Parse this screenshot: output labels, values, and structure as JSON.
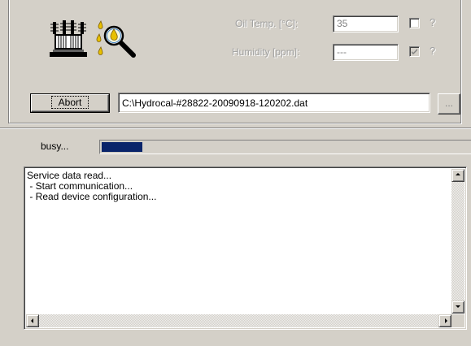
{
  "measurement": {
    "oil_temp_label": "Oil Temp. [°C]:",
    "oil_temp_value": "35",
    "oil_temp_checked": false,
    "oil_temp_help": "?",
    "humidity_label": "Humidity [ppm]:",
    "humidity_value": "---",
    "humidity_checked": true,
    "humidity_help": "?"
  },
  "icons": {
    "transformer": "transformer-icon",
    "sample_inspect": "oil-drop-magnifier-icon"
  },
  "file_row": {
    "abort_label": "Abort",
    "file_path": "C:\\Hydrocal-#28822-20090918-120202.dat",
    "browse_label": "..."
  },
  "status": {
    "text": "busy...",
    "progress_fraction": 0.11
  },
  "log": {
    "lines": [
      "Service data read...",
      " - Start communication...",
      " - Read device configuration..."
    ]
  },
  "colors": {
    "window_bg": "#d4d0c8",
    "progress_fill": "#0a246a",
    "disabled_text": "#a0a0a0"
  }
}
